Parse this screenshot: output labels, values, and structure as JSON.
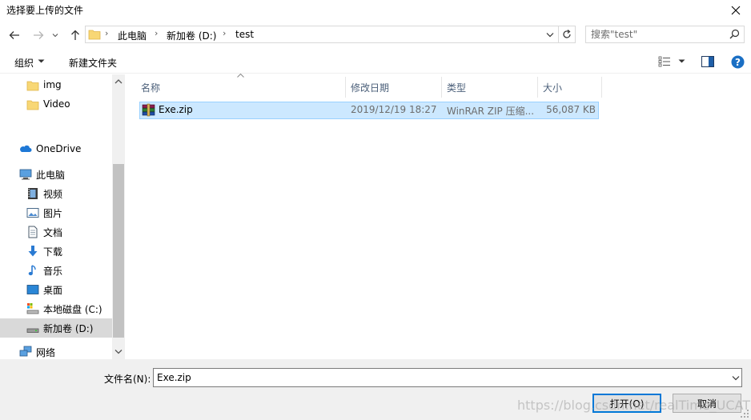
{
  "window": {
    "title": "选择要上传的文件",
    "close_glyph": "✕"
  },
  "address": {
    "crumbs": [
      "此电脑",
      "新加卷 (D:)",
      "test"
    ],
    "separator": "›"
  },
  "search": {
    "placeholder": "搜索\"test\""
  },
  "toolbar": {
    "organize": "组织",
    "new_folder": "新建文件夹"
  },
  "sidebar": {
    "items": [
      {
        "label": "img",
        "icon": "folder-icon"
      },
      {
        "label": "Video",
        "icon": "folder-icon"
      },
      {
        "label": "OneDrive",
        "icon": "onedrive-cloud-icon"
      },
      {
        "label": "此电脑",
        "icon": "this-pc-icon"
      },
      {
        "label": "视频",
        "icon": "videos-icon"
      },
      {
        "label": "图片",
        "icon": "pictures-icon"
      },
      {
        "label": "文档",
        "icon": "documents-icon"
      },
      {
        "label": "下载",
        "icon": "downloads-icon"
      },
      {
        "label": "音乐",
        "icon": "music-icon"
      },
      {
        "label": "桌面",
        "icon": "desktop-icon"
      },
      {
        "label": "本地磁盘 (C:)",
        "icon": "local-disk-icon"
      },
      {
        "label": "新加卷 (D:)",
        "icon": "drive-icon",
        "selected": true
      },
      {
        "label": "网络",
        "icon": "network-icon"
      }
    ]
  },
  "columns": {
    "name": "名称",
    "modified": "修改日期",
    "type": "类型",
    "size": "大小"
  },
  "files": [
    {
      "name": "Exe.zip",
      "modified": "2019/12/19 18:27",
      "type": "WinRAR ZIP 压缩...",
      "size": "56,087 KB",
      "icon": "winrar-archive-icon"
    }
  ],
  "footer": {
    "filename_label": "文件名(N):",
    "filename_value": "Exe.zip",
    "open_label": "打开(O)",
    "cancel_label": "取消"
  },
  "watermark": "https://blog.csdn.net/realTime_UCAT",
  "colors": {
    "selection_bg": "#cce8ff",
    "selection_border": "#99d1ff",
    "accent": "#0078d7",
    "help": "#1a6fc4"
  }
}
